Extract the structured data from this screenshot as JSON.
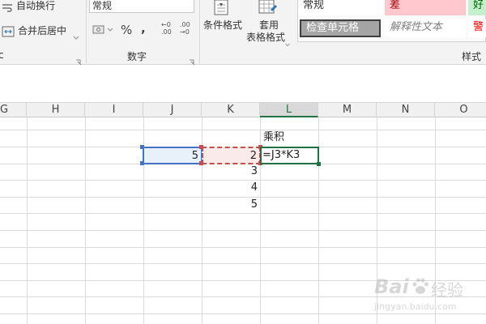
{
  "ribbon": {
    "wrap_text": "自动换行",
    "merge_center": "合并后居中",
    "number_format": "常规",
    "percent": "%",
    "comma": ",",
    "dec_increase": "←0 .00",
    "dec_decrease": ".00 →0",
    "number_group_label": "数字",
    "cond_format": "条件格式",
    "table_format_line1": "套用",
    "table_format_line2": "表格格式",
    "styles_group_label": "样式",
    "alignment_group_fragment": "c",
    "styles": {
      "normal": "常规",
      "bad": "差",
      "good": "好",
      "check_cell": "检查单元格",
      "explanatory": "解释性文本",
      "warning": "警"
    }
  },
  "columns": [
    "G",
    "H",
    "I",
    "J",
    "K",
    "L",
    "M",
    "N",
    "O"
  ],
  "active_column": "L",
  "cells": {
    "L2": "乘积",
    "J3": "5",
    "K3": "2",
    "L3": "=J3*K3",
    "K4": "3",
    "K5": "4",
    "K6": "5"
  },
  "watermark": {
    "brand": "Bai",
    "brand_cn": "经验",
    "url": "jingyan.baidu.com"
  },
  "colors": {
    "excel_green": "#217346",
    "ref_blue": "#4472c4",
    "ref_red": "#c0504d",
    "check_cell_bg": "#a5a5a5",
    "bad_bg": "#ffc7ce"
  }
}
